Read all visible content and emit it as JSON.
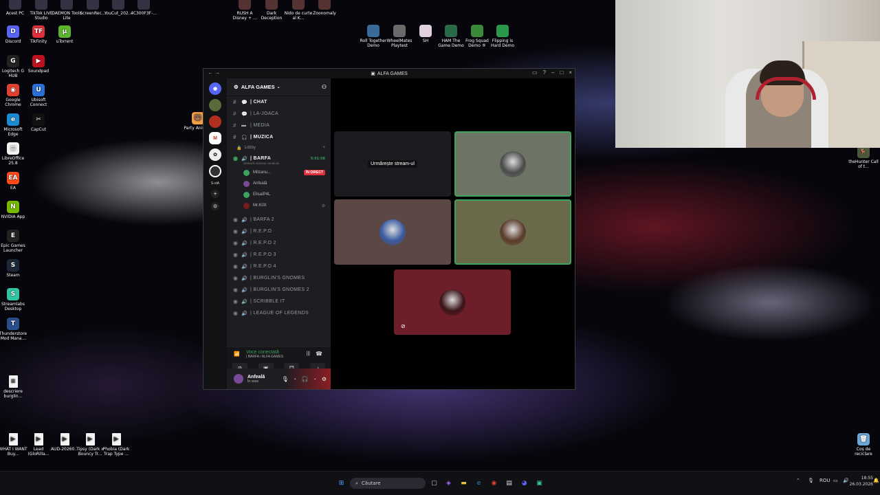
{
  "desktop": {
    "top_icons": [
      "Acest PC",
      "TikTok LIVE Studio",
      "DAEMON Tools Lite",
      "ScreenRec...",
      "YouCut_202...",
      "4C300F3F-..."
    ],
    "top_mid_icons": [
      "RUSH A Disney + ...",
      "Dark Deception",
      "Nido de curte al K...",
      "Zoonomaly"
    ],
    "left_icons": [
      {
        "label": "Discord",
        "color": "#5865f2",
        "glyph": "D"
      },
      {
        "label": "TikFinity",
        "color": "#e0303c",
        "glyph": "TF"
      },
      {
        "label": "uTorrent",
        "color": "#5bb62e",
        "glyph": "µ"
      },
      {
        "label": "Logitech G HUB",
        "color": "#222",
        "glyph": "G"
      },
      {
        "label": "Soundpad",
        "color": "#c01020",
        "glyph": "▶"
      },
      {
        "label": "Google Chrome",
        "color": "#e04030",
        "glyph": "◉"
      },
      {
        "label": "Ubisoft Connect",
        "color": "#2a6fd6",
        "glyph": "U"
      },
      {
        "label": "Microsoft Edge",
        "color": "#1a8bd0",
        "glyph": "e"
      },
      {
        "label": "CapCut",
        "color": "#111",
        "glyph": "✂"
      },
      {
        "label": "LibreOffice 25.8",
        "color": "#f2f2f2",
        "glyph": "▤"
      },
      {
        "label": "EA",
        "color": "#ff4a1a",
        "glyph": "EA"
      },
      {
        "label": "NVIDIA App",
        "color": "#76b900",
        "glyph": "N"
      },
      {
        "label": "Epic Games Launcher",
        "color": "#222",
        "glyph": "E"
      },
      {
        "label": "Steam",
        "color": "#1b2838",
        "glyph": "S"
      },
      {
        "label": "Streamlabs Desktop",
        "color": "#31c3a2",
        "glyph": "S"
      },
      {
        "label": "Thunderstore Mod Mana...",
        "color": "#2a4e8a",
        "glyph": "T"
      },
      {
        "label": "descriere burglin...",
        "color": "#f4f4f4",
        "glyph": "≡"
      }
    ],
    "shortcut_row": [
      "Roll Together Demo",
      "WheelMates Playtest",
      "SH",
      "HAM The Game Demo",
      "Frog Squad Demo ®",
      "Flipping is Hard Demo"
    ],
    "party_animals": "Party Animals",
    "thehunter": "theHunter Call of t...",
    "bottom_files": [
      "WHAT I WANT Buy...",
      "Lead (GloRilla...",
      "AUD-20260...",
      "Tipsy (Dark x Bouncy Tr...",
      "Phobia (Dark Trap Type ..."
    ],
    "recycle_bin": "Coș de reciclare"
  },
  "discord": {
    "window_title": "ALFA GAMES",
    "server_name": "ALFA GAMES",
    "server_abbrev": "S-olA",
    "text_channels": [
      {
        "name": "| CHAT",
        "icon": "💬",
        "bold": true
      },
      {
        "name": "| LA-JOACA",
        "icon": "💬",
        "bold": false
      },
      {
        "name": "| MEDIA",
        "icon": "▬",
        "bold": false
      },
      {
        "name": "| MUZICA",
        "icon": "🎧",
        "bold": true
      }
    ],
    "lobby_label": "Lobby",
    "active_voice": {
      "name": "| BARFA",
      "timer": "5:01:08",
      "status": "Setează statusul canalului",
      "members": [
        {
          "name": "Mitzanu...",
          "live": "ÎN DIRECT",
          "color": "#3ba55d"
        },
        {
          "name": "Anfeală",
          "color": "#7a4a9a"
        },
        {
          "name": "ElisaIP4L",
          "color": "#3ba55d"
        },
        {
          "name": "Mr.K0X",
          "color": "#7a1a1a"
        }
      ]
    },
    "voice_channels": [
      "| BARFA 2",
      "| R.E.P.O",
      "| R.E.P.O 2",
      "| R.E.P.O 3",
      "| R.E.P.O 4",
      "| BURGLIN'S GNOMES",
      "| BURGLIN'S GNOMES 2",
      "| SCRIBBLE IT",
      "| LEAGUE OF LEGENDS"
    ],
    "voice_connected": "Voce conectată",
    "voice_location": "| BARFA / ALFA GAMES",
    "user": {
      "name": "Anfeală",
      "status": "În voce"
    },
    "stream_watch_label": "Urmărește stream-ul",
    "tiles": [
      {
        "kind": "stream",
        "bg": "#1c1c20"
      },
      {
        "kind": "avatar",
        "bg": "#6d7466",
        "speaking": true
      },
      {
        "kind": "avatar",
        "bg": "#5b4744"
      },
      {
        "kind": "avatar",
        "bg": "#6a6a4a",
        "speaking": true
      },
      {
        "kind": "avatar",
        "bg": "#6e1e28",
        "muted": true
      }
    ]
  },
  "taskbar": {
    "search_placeholder": "Căutare",
    "language": "ROU",
    "time": "18:55",
    "date": "26.03.2026"
  }
}
